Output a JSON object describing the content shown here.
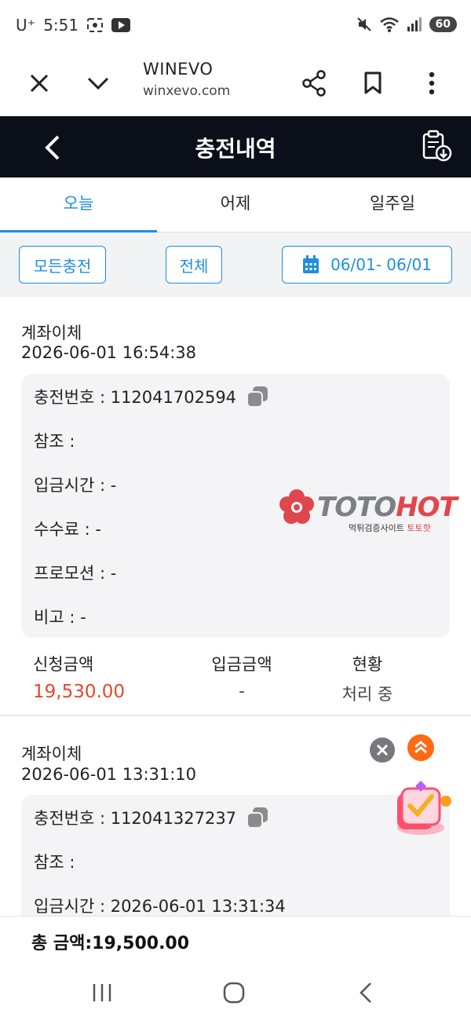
{
  "status_bar": {
    "carrier": "U⁺",
    "time": "5:51",
    "battery": "60"
  },
  "browser": {
    "site_title": "WINEVO",
    "url": "winxevo.com"
  },
  "header": {
    "title": "충전내역"
  },
  "tabs": [
    {
      "label": "오늘",
      "active": true
    },
    {
      "label": "어제",
      "active": false
    },
    {
      "label": "일주일",
      "active": false
    }
  ],
  "filters": {
    "type": "모든충전",
    "status": "전체",
    "date_range": "06/01- 06/01"
  },
  "records": [
    {
      "type": "계좌이체",
      "datetime": "2026-06-01 16:54:38",
      "charge_no": "충전번호 : 112041702594",
      "reference": "참조 :",
      "deposit_time": "입금시간 : -",
      "fee": "수수료 : -",
      "promotion": "프로모션 : -",
      "note": "비고 : -",
      "requested_label": "신청금액",
      "requested_amount": "19,530.00",
      "deposit_label": "입금금액",
      "deposit_amount": "-",
      "status_label": "현황",
      "status_value": "처리 중"
    },
    {
      "type": "계좌이체",
      "datetime": "2026-06-01 13:31:10",
      "charge_no": "충전번호 : 112041327237",
      "reference": "참조 :",
      "deposit_time": "입금시간 : 2026-06-01 13:31:34"
    }
  ],
  "watermark": {
    "brand_main": "TOTO",
    "brand_accent": "HOT",
    "sub_main": "먹튀검증사이트 ",
    "sub_accent": "토토핫"
  },
  "total": {
    "text": "총 금액:19,500.00"
  },
  "colors": {
    "accent": "#1d8fe1",
    "amount_red": "#e8472b",
    "header_bg": "#0a0f1a",
    "scroll_top_orange": "#ff6a13"
  }
}
